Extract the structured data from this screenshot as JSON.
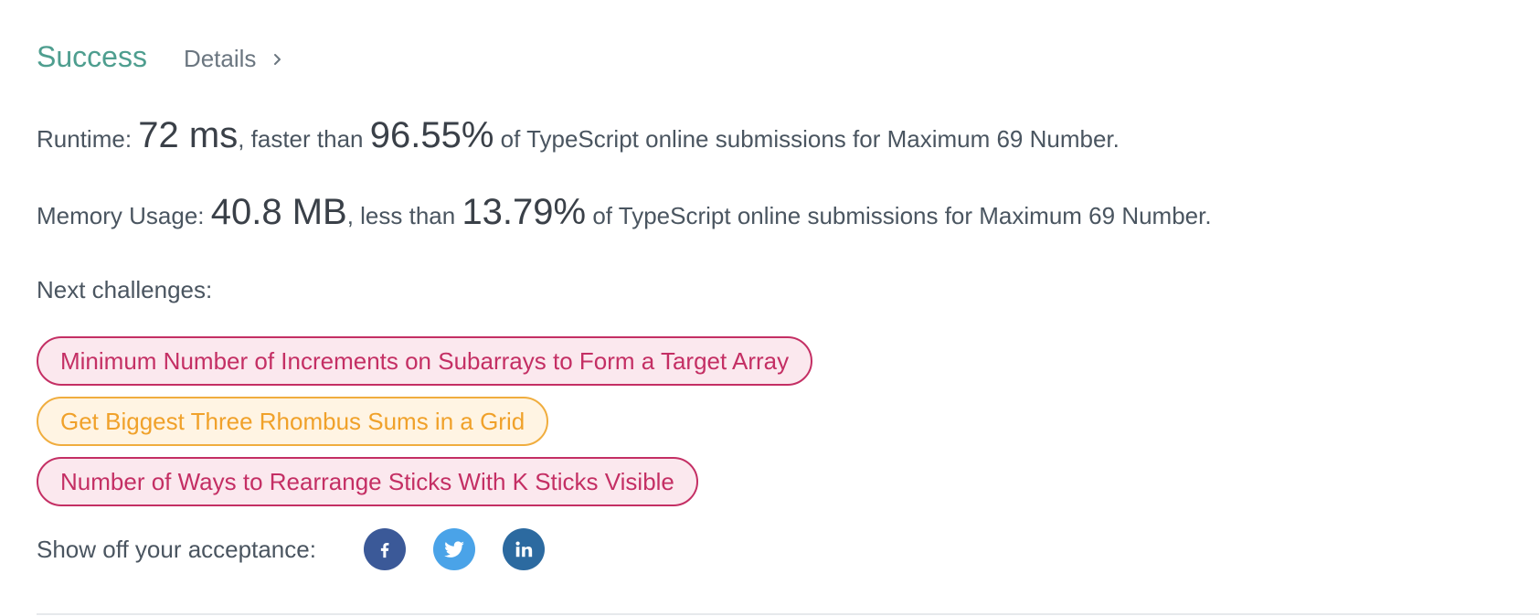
{
  "result": {
    "status": "Success",
    "details_label": "Details"
  },
  "runtime": {
    "label": "Runtime: ",
    "value": "72 ms",
    "comparison": ", faster than ",
    "percent": "96.55%",
    "suffix": " of TypeScript online submissions for Maximum 69 Number."
  },
  "memory": {
    "label": "Memory Usage: ",
    "value": "40.8 MB",
    "comparison": ", less than ",
    "percent": "13.79%",
    "suffix": " of TypeScript online submissions for Maximum 69 Number."
  },
  "next_challenges": {
    "title": "Next challenges:",
    "items": [
      {
        "label": "Minimum Number of Increments on Subarrays to Form a Target Array",
        "difficulty": "hard",
        "color": "#c42f64"
      },
      {
        "label": "Get Biggest Three Rhombus Sums in a Grid",
        "difficulty": "medium",
        "color": "#f0a12a"
      },
      {
        "label": "Number of Ways to Rearrange Sticks With K Sticks Visible",
        "difficulty": "hard",
        "color": "#c42f64"
      }
    ]
  },
  "share": {
    "label": "Show off your acceptance:",
    "icons": [
      "facebook-icon",
      "twitter-icon",
      "linkedin-icon"
    ]
  },
  "colors": {
    "success": "#4e9e8f",
    "facebook": "#3b5998",
    "twitter": "#4aa3e8",
    "linkedin": "#2c6aa0"
  }
}
